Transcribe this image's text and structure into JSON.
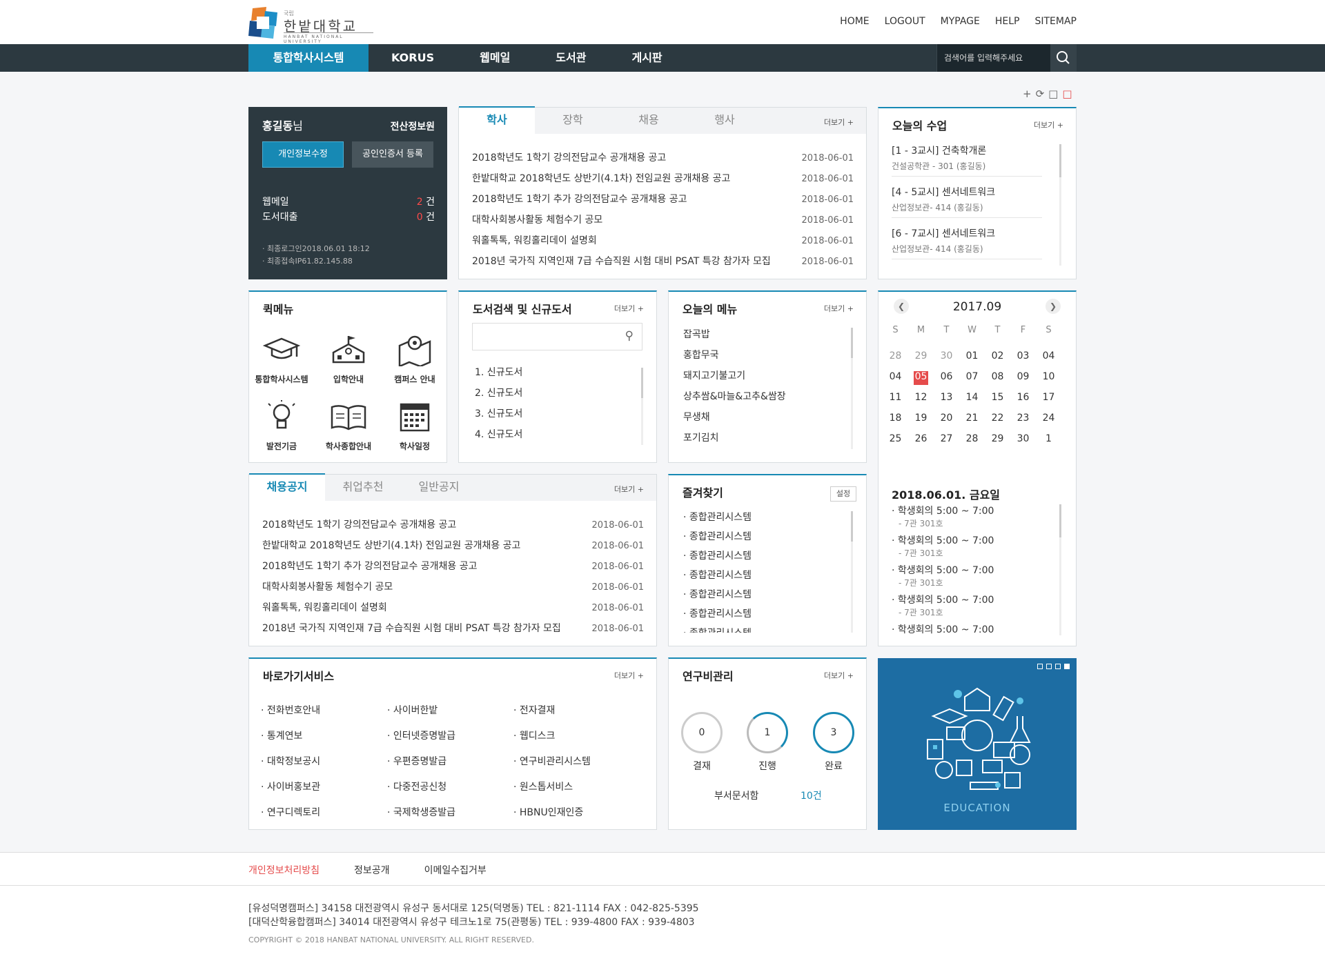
{
  "header": {
    "logo_small": "국립",
    "logo_name": "한밭대학교",
    "logo_en": "HANBAT NATIONAL UNIVERSITY",
    "utils": [
      "HOME",
      "LOGOUT",
      "MYPAGE",
      "HELP",
      "SITEMAP"
    ]
  },
  "gnb": {
    "items": [
      "통합학사시스템",
      "KORUS",
      "웹메일",
      "도서관",
      "게시판"
    ],
    "search_placeholder": "검색어를 입력해주세요"
  },
  "user": {
    "name": "홍길동",
    "suffix": "님",
    "dept": "전산정보원",
    "btn_edit": "개인정보수정",
    "btn_cert": "공인인증서 등록",
    "mail_label": "웹메일",
    "mail_count": "2",
    "loan_label": "도서대출",
    "loan_count": "0",
    "unit": "건",
    "last_login": "· 최종로그인2018.06.01 18:12",
    "last_ip": "· 최종접속IP61.82.145.88"
  },
  "notice": {
    "tabs": [
      "학사",
      "장학",
      "채용",
      "행사"
    ],
    "more": "더보기 +",
    "rows": [
      {
        "t": "2018학년도 1학기 강의전담교수 공개채용 공고",
        "d": "2018-06-01"
      },
      {
        "t": "한밭대학교 2018학년도 상반기(4.1차) 전임교원 공개채용 공고",
        "d": "2018-06-01"
      },
      {
        "t": "2018학년도 1학기 추가 강의전담교수 공개채용 공고",
        "d": "2018-06-01"
      },
      {
        "t": "대학사회봉사활동 체험수기 공모",
        "d": "2018-06-01"
      },
      {
        "t": "워홀톡톡, 워킹홀리데이 설명회",
        "d": "2018-06-01"
      },
      {
        "t": "2018년 국가직 지역인재 7급 수습직원 시험 대비 PSAT 특강 참가자 모집",
        "d": "2018-06-01"
      }
    ]
  },
  "classes": {
    "title": "오늘의 수업",
    "more": "더보기 +",
    "items": [
      {
        "t": "[1 - 3교시] 건축학개론",
        "s": "건설공학관 - 301 (홍길동)"
      },
      {
        "t": "[4 - 5교시] 센서네트워크",
        "s": "산업정보관- 414 (홍길동)"
      },
      {
        "t": "[6 - 7교시] 센서네트워크",
        "s": "산업정보관- 414 (홍길동)"
      }
    ]
  },
  "quick": {
    "title": "퀵메뉴",
    "items": [
      "통합학사시스템",
      "입학안내",
      "캠퍼스 안내",
      "발전기금",
      "학사종합안내",
      "학사일정"
    ]
  },
  "library": {
    "title": "도서검색 및 신규도서",
    "more": "더보기 +",
    "items": [
      "1. 신규도서",
      "2. 신규도서",
      "3. 신규도서",
      "4. 신규도서"
    ]
  },
  "menu": {
    "title": "오늘의 메뉴",
    "more": "더보기 +",
    "items": [
      "잡곡밥",
      "홍합무국",
      "돼지고기불고기",
      "상추쌈&마늘&고추&쌈장",
      "무생채",
      "포기김치"
    ]
  },
  "calendar": {
    "month": "2017.09",
    "weekdays": [
      "S",
      "M",
      "T",
      "W",
      "T",
      "F",
      "S"
    ],
    "weeks": [
      [
        "28",
        "29",
        "30",
        "01",
        "02",
        "03",
        "04"
      ],
      [
        "04",
        "05",
        "06",
        "07",
        "08",
        "09",
        "10"
      ],
      [
        "11",
        "12",
        "13",
        "14",
        "15",
        "16",
        "17"
      ],
      [
        "18",
        "19",
        "20",
        "21",
        "22",
        "23",
        "24"
      ],
      [
        "25",
        "26",
        "27",
        "28",
        "29",
        "30",
        "1"
      ]
    ],
    "selected_date": "2018.06.01. 금요일",
    "events": [
      {
        "t": "· 학생회의 5:00 ~ 7:00",
        "r": "- 7관 301호"
      },
      {
        "t": "· 학생회의 5:00 ~ 7:00",
        "r": "- 7관 301호"
      },
      {
        "t": "· 학생회의 5:00 ~ 7:00",
        "r": "- 7관 301호"
      },
      {
        "t": "· 학생회의 5:00 ~ 7:00",
        "r": "- 7관 301호"
      },
      {
        "t": "· 학생회의 5:00 ~ 7:00",
        "r": ""
      }
    ]
  },
  "jobs": {
    "tabs": [
      "채용공지",
      "취업추천",
      "일반공지"
    ],
    "more": "더보기 +",
    "rows": [
      {
        "t": "2018학년도 1학기 강의전담교수 공개채용 공고",
        "d": "2018-06-01"
      },
      {
        "t": "한밭대학교 2018학년도 상반기(4.1차) 전임교원 공개채용 공고",
        "d": "2018-06-01"
      },
      {
        "t": "2018학년도 1학기 추가 강의전담교수 공개채용 공고",
        "d": "2018-06-01"
      },
      {
        "t": "대학사회봉사활동 체험수기 공모",
        "d": "2018-06-01"
      },
      {
        "t": "워홀톡톡, 워킹홀리데이 설명회",
        "d": "2018-06-01"
      },
      {
        "t": "2018년 국가직 지역인재 7급 수습직원 시험 대비 PSAT 특강 참가자 모집",
        "d": "2018-06-01"
      }
    ]
  },
  "fav": {
    "title": "즐겨찾기",
    "setting": "설정",
    "items": [
      "· 종합관리시스템",
      "· 종합관리시스템",
      "· 종합관리시스템",
      "· 종합관리시스템",
      "· 종합관리시스템",
      "· 종합관리시스템",
      "· 종합관리시스템"
    ]
  },
  "services": {
    "title": "바로가기서비스",
    "more": "더보기 +",
    "items": [
      "· 전화번호안내",
      "· 사이버한밭",
      "· 전자결재",
      "· 통계연보",
      "· 인터넷증명발급",
      "· 웹디스크",
      "· 대학정보공시",
      "· 우편증명발급",
      "· 연구비관리시스템",
      "· 사이버홍보관",
      "· 다중전공신청",
      "· 원스톱서비스",
      "· 연구디렉토리",
      "· 국제학생증발급",
      "· HBNU인재인증"
    ]
  },
  "research": {
    "title": "연구비관리",
    "more": "더보기 +",
    "counts": [
      "0",
      "1",
      "3"
    ],
    "labels": [
      "결재",
      "진행",
      "완료"
    ],
    "dept_label": "부서문서함",
    "dept_value": "10건"
  },
  "banner": {
    "label": "EDUCATION"
  },
  "footer": {
    "links": [
      "개인정보처리방침",
      "정보공개",
      "이메일수집거부"
    ],
    "addr1": "[유성덕명캠퍼스] 34158 대전광역시 유성구 동서대로 125(덕명동) TEL : 821-1114 FAX : 042-825-5395",
    "addr2": "[대덕산학융합캠퍼스] 34014 대전광역시 유성구 테크노1로 75(관평동) TEL : 939-4800 FAX : 939-4803",
    "copyright": "COPYRIGHT © 2018 HANBAT NATIONAL UNIVERSITY. ALL RIGHT RESERVED."
  }
}
